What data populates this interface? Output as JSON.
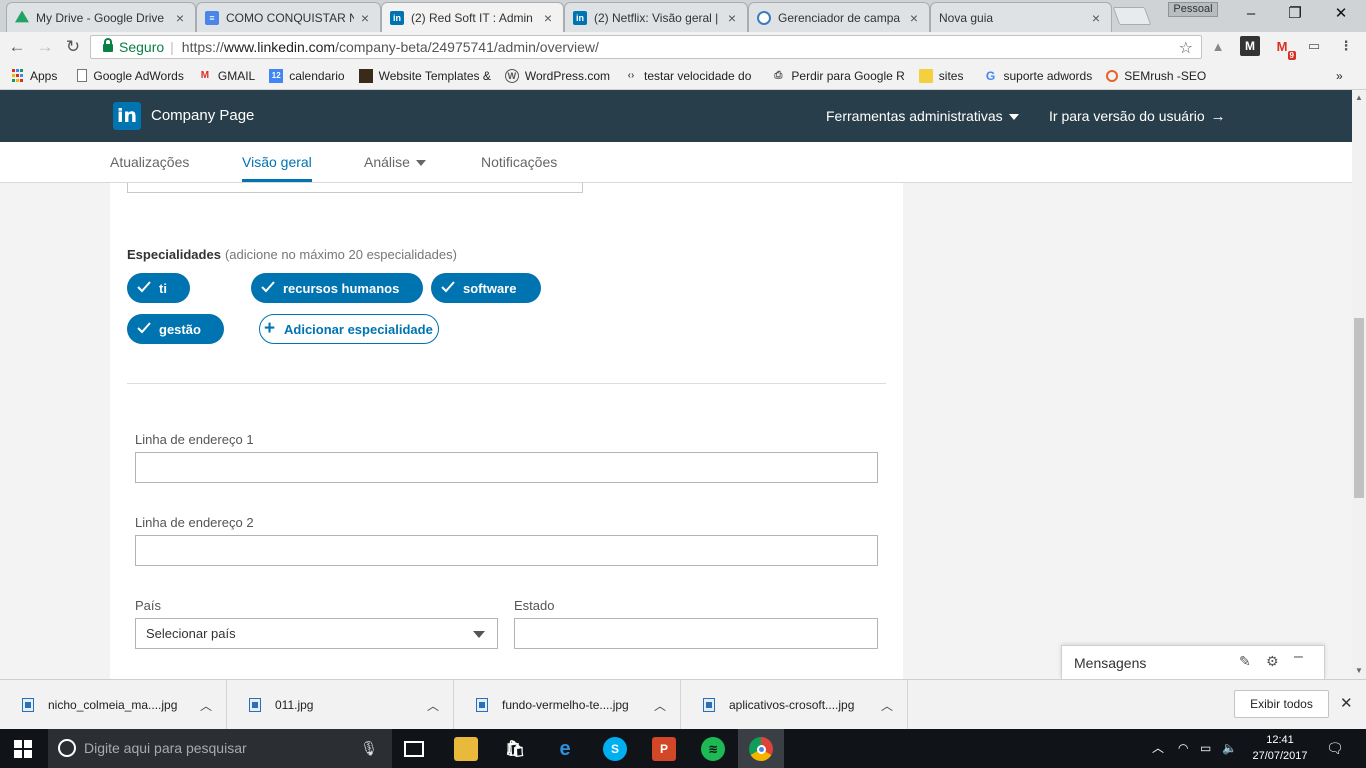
{
  "browser": {
    "tabs": [
      {
        "title": "My Drive - Google Drive",
        "icon": "drive-icon",
        "color": "#1fa463"
      },
      {
        "title": "COMO CONQUISTAR N",
        "icon": "docs-icon",
        "color": "#4a86e8"
      },
      {
        "title": "(2) Red Soft IT : Admin",
        "icon": "linkedin-icon",
        "color": "#0073b1"
      },
      {
        "title": "(2) Netflix: Visão geral |",
        "icon": "linkedin-icon",
        "color": "#0073b1"
      },
      {
        "title": "Gerenciador de campa",
        "icon": "campaign-icon",
        "color": "#3b7bbf"
      },
      {
        "title": "Nova guia",
        "icon": "",
        "color": ""
      }
    ],
    "profile_label": "Pessoal",
    "secure_label": "Seguro",
    "url_scheme": "https://",
    "url_host": "www.linkedin.com",
    "url_path": "/company-beta/24975741/admin/overview/",
    "gmail_badge": "9",
    "bookmarks": [
      {
        "label": "Apps",
        "icon": "apps-grid-icon"
      },
      {
        "label": "Google AdWords",
        "icon": "page-icon"
      },
      {
        "label": "GMAIL",
        "icon": "gmail-icon"
      },
      {
        "label": "calendario",
        "icon": "calendar-icon"
      },
      {
        "label": "Website Templates &",
        "icon": "template-icon"
      },
      {
        "label": "WordPress.com",
        "icon": "wordpress-icon"
      },
      {
        "label": "testar velocidade do",
        "icon": "speed-icon"
      },
      {
        "label": "Perdir para Google R",
        "icon": "print-icon"
      },
      {
        "label": "sites",
        "icon": "folder-icon"
      },
      {
        "label": "suporte adwords",
        "icon": "google-icon"
      },
      {
        "label": "SEMrush -SEO",
        "icon": "semrush-icon"
      }
    ],
    "more_bookmarks": "»"
  },
  "linkedin": {
    "logo_text": "in",
    "header_title": "Company Page",
    "admin_tools": "Ferramentas administrativas",
    "user_view": "Ir para versão do usuário",
    "subnav": {
      "updates": "Atualizações",
      "overview": "Visão geral",
      "analytics": "Análise",
      "notifications": "Notificações"
    },
    "specialties": {
      "label": "Especialidades",
      "hint": "(adicione no máximo 20 especialidades)",
      "items": [
        "ti",
        "recursos humanos",
        "software",
        "gestão"
      ],
      "add_label": "Adicionar especialidade"
    },
    "address": {
      "line1_label": "Linha de endereço 1",
      "line1_value": "",
      "line2_label": "Linha de endereço 2",
      "line2_value": "",
      "country_label": "País",
      "country_value": "Selecionar país",
      "state_label": "Estado",
      "state_value": ""
    },
    "messaging": {
      "label": "Mensagens"
    },
    "accent_color": "#0073b1",
    "header_color": "#283e4a"
  },
  "downloads": {
    "items": [
      "nicho_colmeia_ma....jpg",
      "011.jpg",
      "fundo-vermelho-te....jpg",
      "aplicativos-crosoft....jpg"
    ],
    "show_all": "Exibir todos"
  },
  "taskbar": {
    "search_placeholder": "Digite aqui para pesquisar",
    "time": "12:41",
    "date": "27/07/2017"
  }
}
